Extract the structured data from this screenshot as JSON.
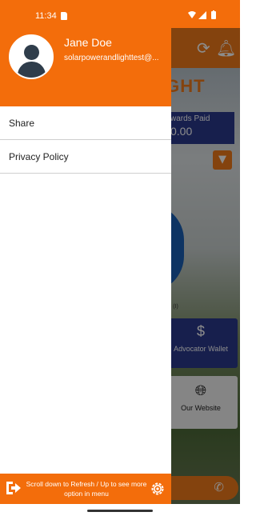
{
  "status_bar": {
    "time": "11:34",
    "icons": [
      "sd-card-icon",
      "wifi-icon",
      "signal-icon",
      "battery-icon"
    ]
  },
  "drawer": {
    "user": {
      "name": "Jane Doe",
      "email": "solarpowerandlighttest@..."
    },
    "menu": [
      {
        "label": "Share"
      },
      {
        "label": "Privacy Policy"
      }
    ],
    "footer": {
      "hint": "Scroll down to Refresh / Up to see more option in menu",
      "left_icon": "exit-icon",
      "right_icon": "gear-icon"
    }
  },
  "background_app": {
    "title": "IGHT",
    "rewards_label": "wards Paid",
    "rewards_value": "0.00",
    "chart_caption": "sed (I)",
    "card1_label": "Advocator Wallet",
    "card2_label": "Our Website"
  },
  "colors": {
    "accent": "#f36d0b",
    "navy": "#2b3a8d"
  }
}
